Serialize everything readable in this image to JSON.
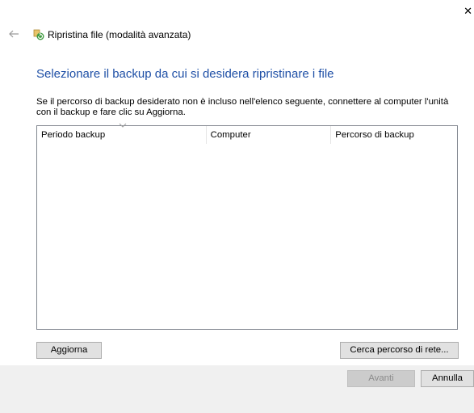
{
  "window": {
    "close_glyph": "✕",
    "back_icon": "back-arrow-icon",
    "app_icon": "restore-files-icon",
    "title": "Ripristina file (modalità avanzata)"
  },
  "main": {
    "heading": "Selezionare il backup da cui si desidera ripristinare i file",
    "instructions": "Se il percorso di backup desiderato non è incluso nell'elenco seguente, connettere al computer l'unità con il backup e fare clic su Aggiorna."
  },
  "listview": {
    "columns": [
      {
        "label": "Periodo backup",
        "sorted": true
      },
      {
        "label": "Computer"
      },
      {
        "label": "Percorso di backup"
      }
    ],
    "rows": []
  },
  "buttons": {
    "refresh": "Aggiorna",
    "network": "Cerca percorso di rete...",
    "next": "Avanti",
    "cancel": "Annulla"
  },
  "colors": {
    "heading": "#1e4fa6",
    "footer_bg": "#f0f0f0",
    "disabled_text": "#8b8b8b"
  }
}
